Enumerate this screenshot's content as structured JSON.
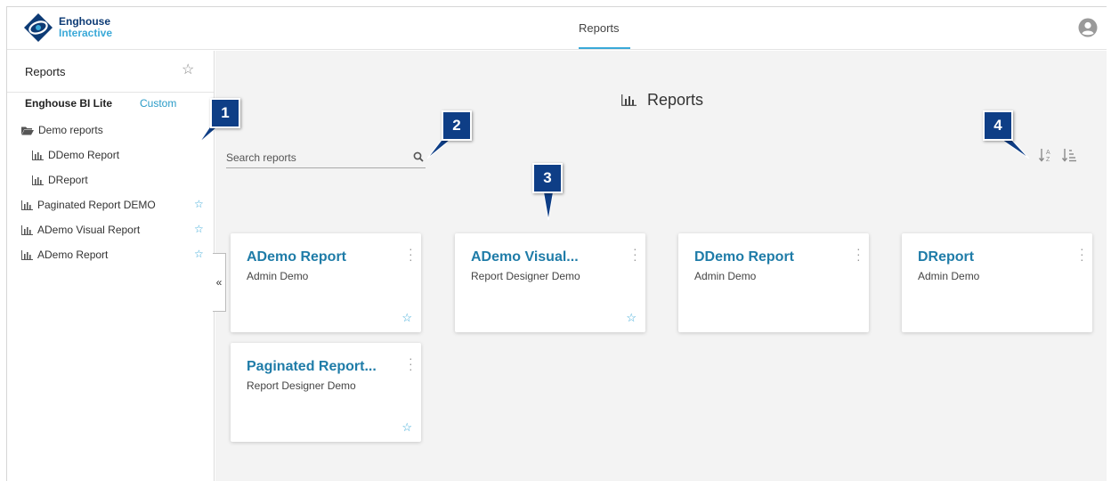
{
  "header": {
    "logo_line1": "Enghouse",
    "logo_line2": "Interactive",
    "active_tab": "Reports"
  },
  "sidebar": {
    "title": "Reports",
    "section_label": "Enghouse BI Lite",
    "custom_link": "Custom",
    "items": [
      {
        "label": "Demo reports",
        "icon": "folder-open-icon",
        "starred": false
      },
      {
        "label": "DDemo Report",
        "icon": "chart-icon",
        "starred": false
      },
      {
        "label": "DReport",
        "icon": "chart-icon",
        "starred": false
      },
      {
        "label": "Paginated Report DEMO",
        "icon": "chart-icon",
        "starred": true
      },
      {
        "label": "ADemo Visual Report",
        "icon": "chart-icon",
        "starred": true
      },
      {
        "label": "ADemo Report",
        "icon": "chart-icon",
        "starred": true
      }
    ],
    "collapse_label": "«"
  },
  "main": {
    "title": "Reports",
    "search_placeholder": "Search reports"
  },
  "cards": [
    {
      "title": "ADemo Report",
      "subtitle": "Admin Demo",
      "starred": true
    },
    {
      "title": "ADemo Visual...",
      "subtitle": "Report Designer Demo",
      "starred": true
    },
    {
      "title": "DDemo Report",
      "subtitle": "Admin Demo",
      "starred": false
    },
    {
      "title": "DReport",
      "subtitle": "Admin Demo",
      "starred": false
    },
    {
      "title": "Paginated Report...",
      "subtitle": "Report Designer Demo",
      "starred": true
    }
  ],
  "callouts": [
    "1",
    "2",
    "3",
    "4"
  ],
  "colors": {
    "accent": "#3aa9d8",
    "card_title": "#1f7ca8",
    "callout": "#0e3e86",
    "main_bg": "#f3f3f3"
  }
}
